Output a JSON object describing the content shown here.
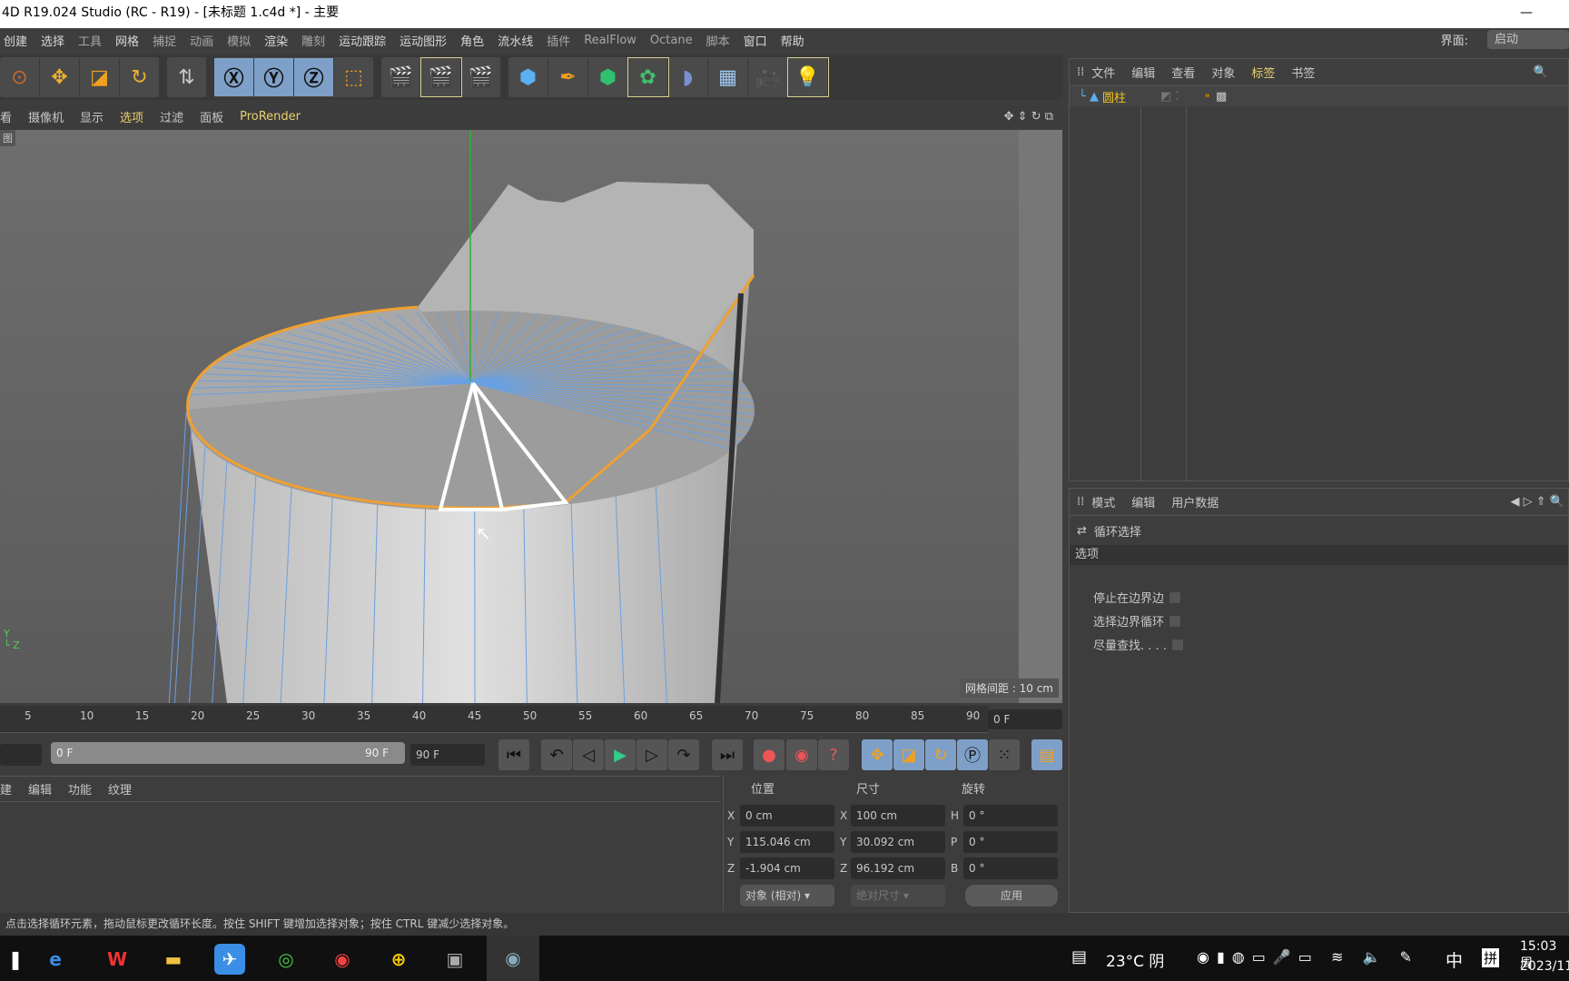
{
  "window": {
    "title": "4D R19.024 Studio (RC - R19) - [未标题 1.c4d *] - 主要",
    "minimize": "—"
  },
  "menu": {
    "items": [
      "创建",
      "选择",
      "工具",
      "网格",
      "捕捉",
      "动画",
      "模拟",
      "渲染",
      "雕刻",
      "运动跟踪",
      "运动图形",
      "角色",
      "流水线",
      "插件",
      "RealFlow",
      "Octane",
      "脚本",
      "窗口",
      "帮助"
    ],
    "interface_label": "界面:",
    "interface_value": "启动"
  },
  "viewport": {
    "menu": [
      "看",
      "摄像机",
      "显示",
      "选项",
      "过滤",
      "面板",
      "ProRender"
    ],
    "active_menu": "选项",
    "corner_label": "图",
    "grid_spacing": "网格间距 : 10 cm",
    "accent_edge": "#f0a030",
    "wire_color": "#6aa0e0"
  },
  "timeline": {
    "ticks": [
      "5",
      "10",
      "15",
      "20",
      "25",
      "30",
      "35",
      "40",
      "45",
      "50",
      "55",
      "60",
      "65",
      "70",
      "75",
      "80",
      "85",
      "90"
    ],
    "current_frame": "0 F",
    "range_start": "0 F",
    "range_end": "90 F",
    "end_frame": "90 F"
  },
  "material_manager": {
    "menu": [
      "建",
      "编辑",
      "功能",
      "纹理"
    ]
  },
  "coordinates": {
    "headers": [
      "位置",
      "尺寸",
      "旋转"
    ],
    "rows": [
      {
        "a": "X",
        "pos": "0 cm",
        "b": "X",
        "size": "100 cm",
        "c": "H",
        "rot": "0 °"
      },
      {
        "a": "Y",
        "pos": "115.046 cm",
        "b": "Y",
        "size": "30.092 cm",
        "c": "P",
        "rot": "0 °"
      },
      {
        "a": "Z",
        "pos": "-1.904 cm",
        "b": "Z",
        "size": "96.192 cm",
        "c": "B",
        "rot": "0 °"
      }
    ],
    "mode": "对象 (相对)",
    "size_mode": "绝对尺寸",
    "apply": "应用"
  },
  "object_manager": {
    "menu": [
      "文件",
      "编辑",
      "查看",
      "对象",
      "标签",
      "书签"
    ],
    "active_menu": "标签",
    "object": "圆柱"
  },
  "attributes": {
    "menu": [
      "模式",
      "编辑",
      "用户数据"
    ],
    "tool": "循环选择",
    "section": "选项",
    "options": [
      {
        "label": "停止在边界边",
        "checked": false
      },
      {
        "label": "选择边界循环",
        "checked": false
      },
      {
        "label": "尽量查找. . . .",
        "checked": false
      }
    ]
  },
  "status": "点击选择循环元素，拖动鼠标更改循环长度。按住 SHIFT 键增加选择对象；按住 CTRL 键减少选择对象。",
  "taskbar": {
    "weather": "23°C 阴",
    "ime": "中",
    "ime2": "拼",
    "time": "15:03 周",
    "date": "2023/11"
  }
}
